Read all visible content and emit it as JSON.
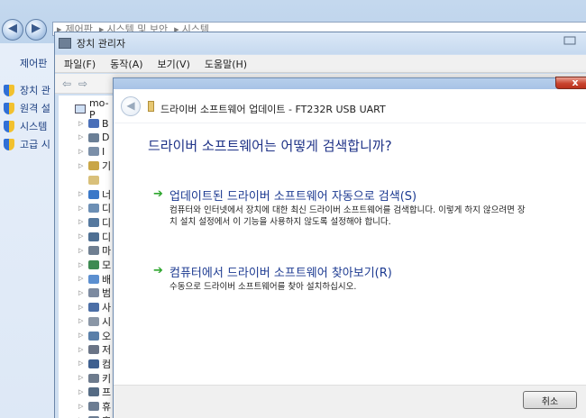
{
  "control_panel": {
    "breadcrumb": [
      "제어판",
      "시스템 및 보안",
      "시스템"
    ],
    "home_label": "제어판",
    "left_items": [
      "장치 관",
      "원격 설",
      "시스템",
      "고급 시"
    ]
  },
  "device_manager": {
    "title": "장치 관리자",
    "menu": [
      "파일(F)",
      "동작(A)",
      "보기(V)",
      "도움말(H)"
    ],
    "root_label": "mo-P",
    "tree_letters": [
      "B",
      "D",
      "I",
      "기",
      "",
      "너",
      "디",
      "디",
      "디",
      "마",
      "모",
      "배",
      "범",
      "사",
      "시",
      "오",
      "저",
      "컴",
      "키",
      "프",
      "휴",
      "휴"
    ]
  },
  "wizard": {
    "title": "드라이버 소프트웨어 업데이트 - FT232R USB UART",
    "question": "드라이버 소프트웨어는 어떻게 검색합니까?",
    "option_auto": {
      "title": "업데이트된 드라이버 소프트웨어 자동으로 검색(S)",
      "desc": "컴퓨터와 인터넷에서 장치에 대한 최신 드라이버 소프트웨어를 검색합니다. 이렇게 하지 않으려면 장치 설치 설정에서 이 기능을 사용하지 않도록 설정해야 합니다."
    },
    "option_browse": {
      "title": "컴퓨터에서 드라이버 소프트웨어 찾아보기(R)",
      "desc": "수동으로 드라이버 소프트웨어를 찾아 설치하십시오."
    },
    "cancel_label": "취소",
    "close_glyph": "x"
  },
  "colors": {
    "link_blue": "#1c3a91",
    "question_blue": "#1e3287",
    "arrow_green": "#2ea62e",
    "close_red": "#c9442e"
  },
  "icons": {
    "back": "back-arrow-icon",
    "forward": "forward-arrow-icon",
    "close": "close-icon",
    "device": "usb-device-icon",
    "option_arrow": "green-arrow-icon",
    "shield": "uac-shield-icon"
  }
}
